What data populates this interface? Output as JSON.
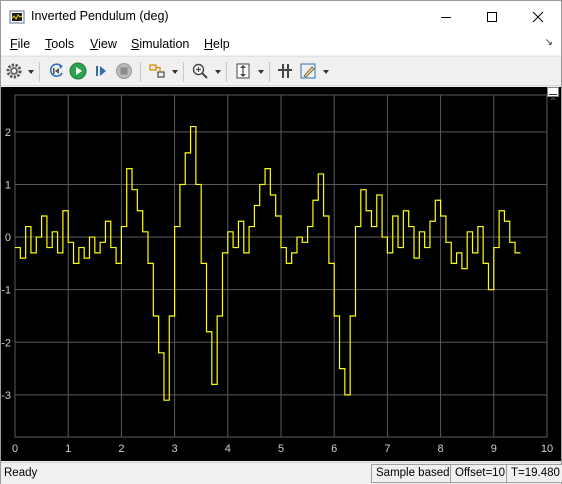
{
  "window": {
    "title": "Inverted Pendulum (deg)",
    "icon": "matlab-scope-icon",
    "controls": [
      "minimize-icon",
      "maximize-icon",
      "close-icon"
    ]
  },
  "menu": [
    {
      "label": "File",
      "hotkey": "F",
      "rest": "ile"
    },
    {
      "label": "Tools",
      "hotkey": "T",
      "rest": "ools"
    },
    {
      "label": "View",
      "hotkey": "V",
      "rest": "iew"
    },
    {
      "label": "Simulation",
      "hotkey": "S",
      "rest": "imulation"
    },
    {
      "label": "Help",
      "hotkey": "H",
      "rest": "elp"
    }
  ],
  "toolbar": {
    "items": [
      "settings-icon",
      "step-back-icon",
      "run-icon",
      "step-forward-icon",
      "stop-icon",
      "highlight-block-icon",
      "zoom-in-icon",
      "autoscale-icon",
      "cursor-measurements-icon",
      "edit-style-icon"
    ]
  },
  "colors": {
    "background": "#000000",
    "grid": "#5a5a5a",
    "trace": "#ffff00",
    "tick_text": "#d0d0d0"
  },
  "status": {
    "left": "Ready",
    "sample": "Sample based",
    "offset": "Offset=10",
    "time": "T=19.480"
  },
  "chart_data": {
    "type": "line",
    "title": "",
    "xlabel": "",
    "ylabel": "",
    "xlim": [
      0,
      10
    ],
    "ylim": [
      -3.8,
      2.7
    ],
    "xticks": [
      0,
      1,
      2,
      3,
      4,
      5,
      6,
      7,
      8,
      9,
      10
    ],
    "yticks": [
      -3,
      -2,
      -1,
      0,
      1,
      2
    ],
    "grid": true,
    "legend": "none",
    "series": [
      {
        "style": "stairs",
        "x": [
          0.0,
          0.1,
          0.2,
          0.3,
          0.4,
          0.5,
          0.6,
          0.7,
          0.8,
          0.9,
          1.0,
          1.1,
          1.2,
          1.3,
          1.4,
          1.5,
          1.6,
          1.7,
          1.8,
          1.9,
          2.0,
          2.1,
          2.2,
          2.3,
          2.4,
          2.5,
          2.6,
          2.7,
          2.8,
          2.9,
          3.0,
          3.1,
          3.2,
          3.3,
          3.4,
          3.5,
          3.6,
          3.7,
          3.8,
          3.9,
          4.0,
          4.1,
          4.2,
          4.3,
          4.4,
          4.5,
          4.6,
          4.7,
          4.8,
          4.9,
          5.0,
          5.1,
          5.2,
          5.3,
          5.4,
          5.5,
          5.6,
          5.7,
          5.8,
          5.9,
          6.0,
          6.1,
          6.2,
          6.3,
          6.4,
          6.5,
          6.6,
          6.7,
          6.8,
          6.9,
          7.0,
          7.1,
          7.2,
          7.3,
          7.4,
          7.5,
          7.6,
          7.7,
          7.8,
          7.9,
          8.0,
          8.1,
          8.2,
          8.3,
          8.4,
          8.5,
          8.6,
          8.7,
          8.8,
          8.9,
          9.0,
          9.1,
          9.2,
          9.3,
          9.4,
          9.5
        ],
        "y": [
          -0.2,
          -0.4,
          0.2,
          -0.3,
          0.0,
          0.4,
          -0.2,
          0.1,
          -0.3,
          0.5,
          -0.1,
          -0.5,
          -0.2,
          -0.4,
          0.0,
          -0.3,
          -0.1,
          0.3,
          -0.2,
          -0.5,
          0.2,
          1.3,
          0.9,
          0.5,
          0.1,
          -0.5,
          -1.5,
          -2.2,
          -3.1,
          -1.5,
          0.2,
          1.0,
          1.6,
          2.1,
          1.0,
          -0.5,
          -1.8,
          -2.8,
          -1.5,
          -0.3,
          0.1,
          -0.2,
          0.3,
          -0.3,
          0.2,
          0.6,
          1.0,
          1.3,
          0.8,
          0.4,
          -0.2,
          -0.5,
          -0.3,
          0.0,
          -0.1,
          0.2,
          0.7,
          1.2,
          0.4,
          -0.5,
          -1.5,
          -2.5,
          -3.0,
          -1.5,
          0.2,
          0.9,
          0.5,
          0.2,
          0.8,
          0.0,
          -0.3,
          0.4,
          -0.2,
          0.5,
          0.2,
          -0.4,
          0.1,
          -0.2,
          0.3,
          0.7,
          0.4,
          -0.1,
          -0.5,
          -0.3,
          -0.6,
          0.1,
          -0.3,
          0.2,
          -0.5,
          -1.0,
          -0.2,
          0.5,
          0.3,
          -0.1,
          -0.3,
          -0.3
        ]
      }
    ]
  }
}
